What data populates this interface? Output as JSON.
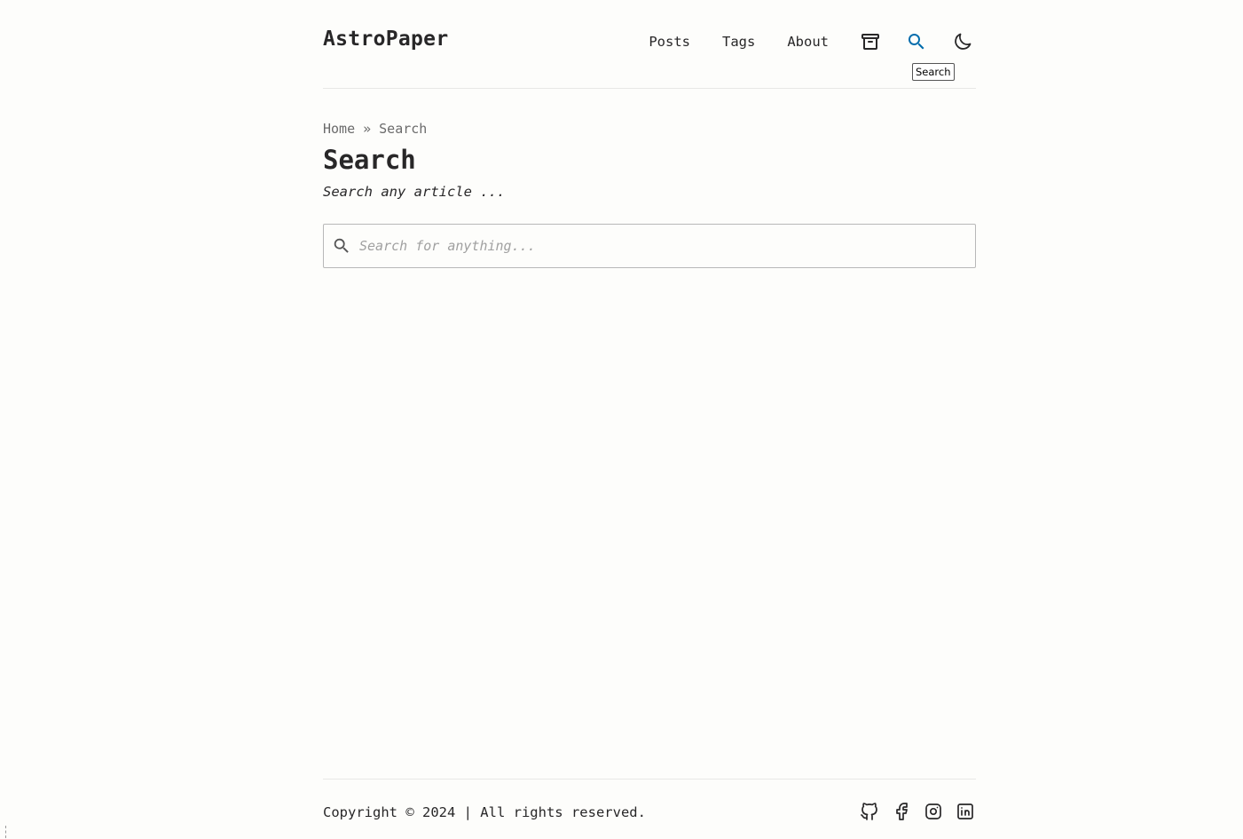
{
  "header": {
    "logo": "AstroPaper",
    "nav": [
      {
        "label": "Posts"
      },
      {
        "label": "Tags"
      },
      {
        "label": "About"
      }
    ],
    "icons": [
      "archive-icon",
      "search-icon",
      "moon-icon"
    ],
    "tooltip": "Search",
    "active_icon_color": "#006cac"
  },
  "breadcrumb": {
    "home": "Home",
    "separator": "»",
    "current": "Search"
  },
  "main": {
    "title": "Search",
    "description": "Search any article ...",
    "search": {
      "placeholder": "Search for anything...",
      "value": ""
    }
  },
  "footer": {
    "copyright": "Copyright © 2024 | All rights reserved.",
    "socials": [
      "github-icon",
      "facebook-icon",
      "instagram-icon",
      "linkedin-icon"
    ]
  },
  "colors": {
    "background": "#fdfdfb",
    "text": "#282728",
    "accent": "#006cac",
    "muted": "#6b6b6b"
  }
}
